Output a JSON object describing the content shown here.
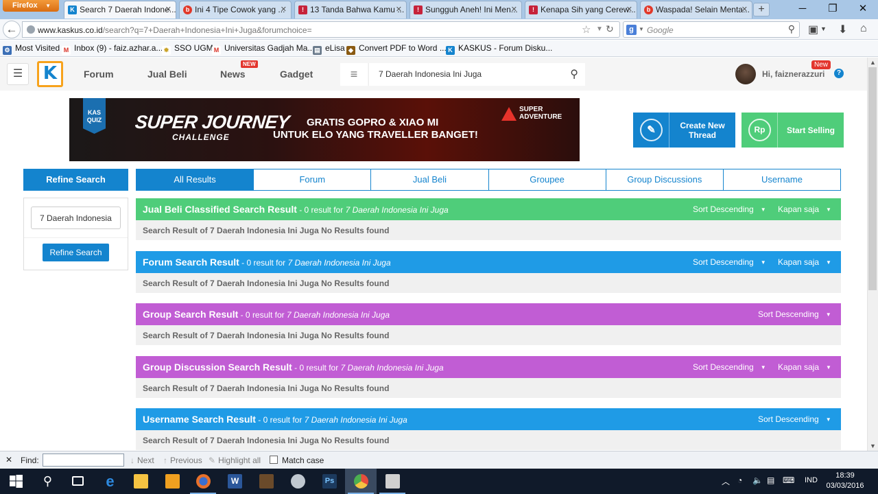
{
  "browser": {
    "menu_label": "Firefox",
    "tabs": [
      {
        "title": "Search 7 Daerah Indone...",
        "icon": "K",
        "color": "#1484ce"
      },
      {
        "title": "Ini 4 Tipe Cowok yang ...",
        "icon": "b",
        "color": "#e1392a"
      },
      {
        "title": "13 Tanda Bahwa Kamu ...",
        "icon": "!",
        "color": "#c6223a"
      },
      {
        "title": "Sungguh Aneh! Ini Men...",
        "icon": "!",
        "color": "#c6223a"
      },
      {
        "title": "Kenapa Sih yang Cerew...",
        "icon": "!",
        "color": "#c6223a"
      },
      {
        "title": "Waspada! Selain Menta...",
        "icon": "b",
        "color": "#e1392a"
      }
    ],
    "url_host": "www.kaskus.co.id",
    "url_path": "/search?q=7+Daerah+Indonesia+Ini+Juga&forumchoice=",
    "search_engine_letter": "g",
    "search_placeholder": "Google",
    "bookmarks": [
      {
        "label": "Most Visited",
        "icon": "gear",
        "color": "#3b6fb6"
      },
      {
        "label": "Inbox (9) - faiz.azhar.a...",
        "icon": "M",
        "color": "#d93025"
      },
      {
        "label": "SSO UGM",
        "icon": "*",
        "color": "#c9a227"
      },
      {
        "label": "Universitas Gadjah Ma...",
        "icon": "M",
        "color": "#d93025"
      },
      {
        "label": "eLisa",
        "icon": "e",
        "color": "#6b7b8c"
      },
      {
        "label": "Convert PDF to Word ...",
        "icon": "C",
        "color": "#8a5a12"
      },
      {
        "label": "KASKUS - Forum Disku...",
        "icon": "K",
        "color": "#1484ce"
      }
    ]
  },
  "header": {
    "nav": [
      "Forum",
      "Jual Beli",
      "News",
      "Gadget"
    ],
    "news_badge": "NEW",
    "search_value": "7 Daerah Indonesia Ini Juga",
    "greeting": "Hi, faiznerazzuri",
    "new_badge": "New",
    "help": "?"
  },
  "banner": {
    "badge_line1": "KAS",
    "badge_line2": "QUIZ",
    "title": "SUPER JOURNEY",
    "subtitle": "CHALLENGE",
    "line1": "GRATIS GOPRO & XIAO MI",
    "line2": "UNTUK ELO YANG TRAVELLER BANGET!",
    "brand_line1": "SUPER",
    "brand_line2": "ADVENTURE"
  },
  "actions": {
    "create_line1": "Create New",
    "create_line2": "Thread",
    "create_color": "#1484ce",
    "sell_label": "Start Selling",
    "sell_icon": "Rp",
    "sell_color": "#4fcd7a"
  },
  "refine": {
    "heading": "Refine Search",
    "input_value": "7 Daerah Indonesia",
    "button": "Refine Search"
  },
  "tabs": [
    "All Results",
    "Forum",
    "Jual Beli",
    "Groupee",
    "Group Discussions",
    "Username"
  ],
  "sections": [
    {
      "title": "Jual Beli Classified Search Result",
      "count": " - 0 result for ",
      "query": "7 Daerah Indonesia Ini Juga",
      "color": "#4fcd7a",
      "sort": "Sort Descending",
      "time": "Kapan saja",
      "message": "Search Result of 7 Daerah Indonesia Ini Juga No Results found"
    },
    {
      "title": "Forum Search Result",
      "count": " - 0 result for ",
      "query": "7 Daerah Indonesia Ini Juga",
      "color": "#1f9be6",
      "sort": "Sort Descending",
      "time": "Kapan saja",
      "message": "Search Result of 7 Daerah Indonesia Ini Juga No Results found"
    },
    {
      "title": "Group Search Result",
      "count": " - 0 result for ",
      "query": "7 Daerah Indonesia Ini Juga",
      "color": "#c15dd4",
      "sort": "Sort Descending",
      "time": "",
      "message": "Search Result of 7 Daerah Indonesia Ini Juga No Results found"
    },
    {
      "title": "Group Discussion Search Result",
      "count": " - 0 result for ",
      "query": "7 Daerah Indonesia Ini Juga",
      "color": "#c15dd4",
      "sort": "Sort Descending",
      "time": "Kapan saja",
      "message": "Search Result of 7 Daerah Indonesia Ini Juga No Results found"
    },
    {
      "title": "Username Search Result",
      "count": " - 0 result for ",
      "query": "7 Daerah Indonesia Ini Juga",
      "color": "#1f9be6",
      "sort": "Sort Descending",
      "time": "",
      "message": "Search Result of 7 Daerah Indonesia Ini Juga No Results found"
    }
  ],
  "findbar": {
    "label": "Find:",
    "next": "Next",
    "previous": "Previous",
    "highlight": "Highlight all",
    "match_case": "Match case"
  },
  "taskbar": {
    "apps": [
      {
        "name": "start",
        "color": "#ffffff"
      },
      {
        "name": "search",
        "color": "#ffffff"
      },
      {
        "name": "task-view",
        "color": "#ffffff"
      },
      {
        "name": "edge",
        "color": "#2d8ae0"
      },
      {
        "name": "file-explorer",
        "color": "#f5c342"
      },
      {
        "name": "media",
        "color": "#f0a020"
      },
      {
        "name": "firefox",
        "color": "#e8702a"
      },
      {
        "name": "word",
        "color": "#2b579a"
      },
      {
        "name": "game",
        "color": "#6a4a2a"
      },
      {
        "name": "app",
        "color": "#c0c8d0"
      },
      {
        "name": "photoshop",
        "color": "#1c3a5e"
      },
      {
        "name": "chrome",
        "color": "#e0a030"
      },
      {
        "name": "clapper",
        "color": "#d0d0d0"
      }
    ],
    "language": "IND",
    "time": "18:39",
    "date": "03/03/2016"
  }
}
